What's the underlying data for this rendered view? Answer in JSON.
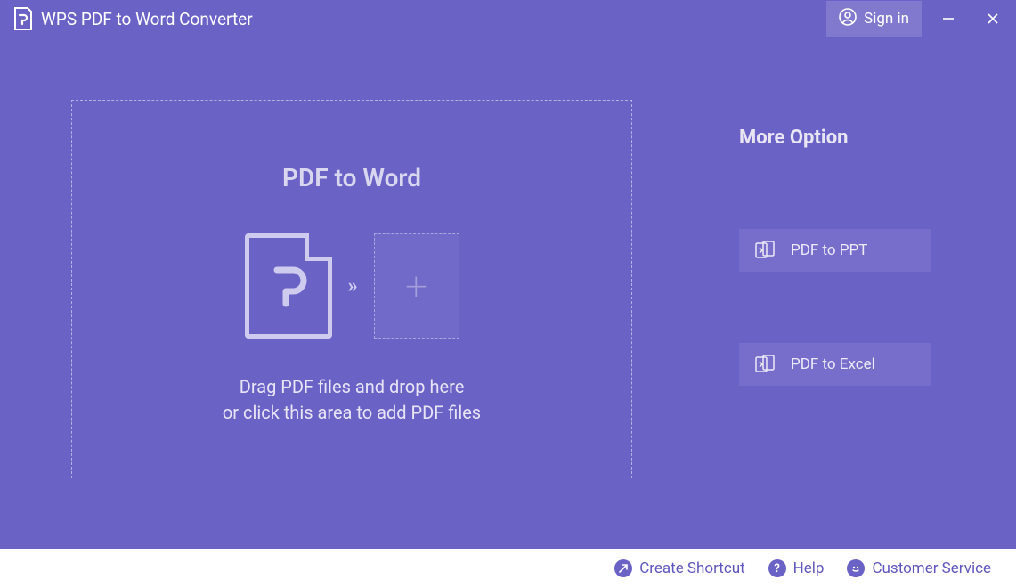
{
  "header": {
    "app_title": "WPS PDF to Word Converter",
    "signin_label": "Sign in"
  },
  "main": {
    "dropzone_title": "PDF to Word",
    "arrow": "»",
    "drop_text_line1": "Drag PDF files and drop here",
    "drop_text_line2": "or click this area to add PDF files"
  },
  "side": {
    "title": "More Option",
    "option_ppt": "PDF to PPT",
    "option_excel": "PDF to Excel"
  },
  "footer": {
    "create_shortcut": "Create Shortcut",
    "help": "Help",
    "customer_service": "Customer Service"
  }
}
